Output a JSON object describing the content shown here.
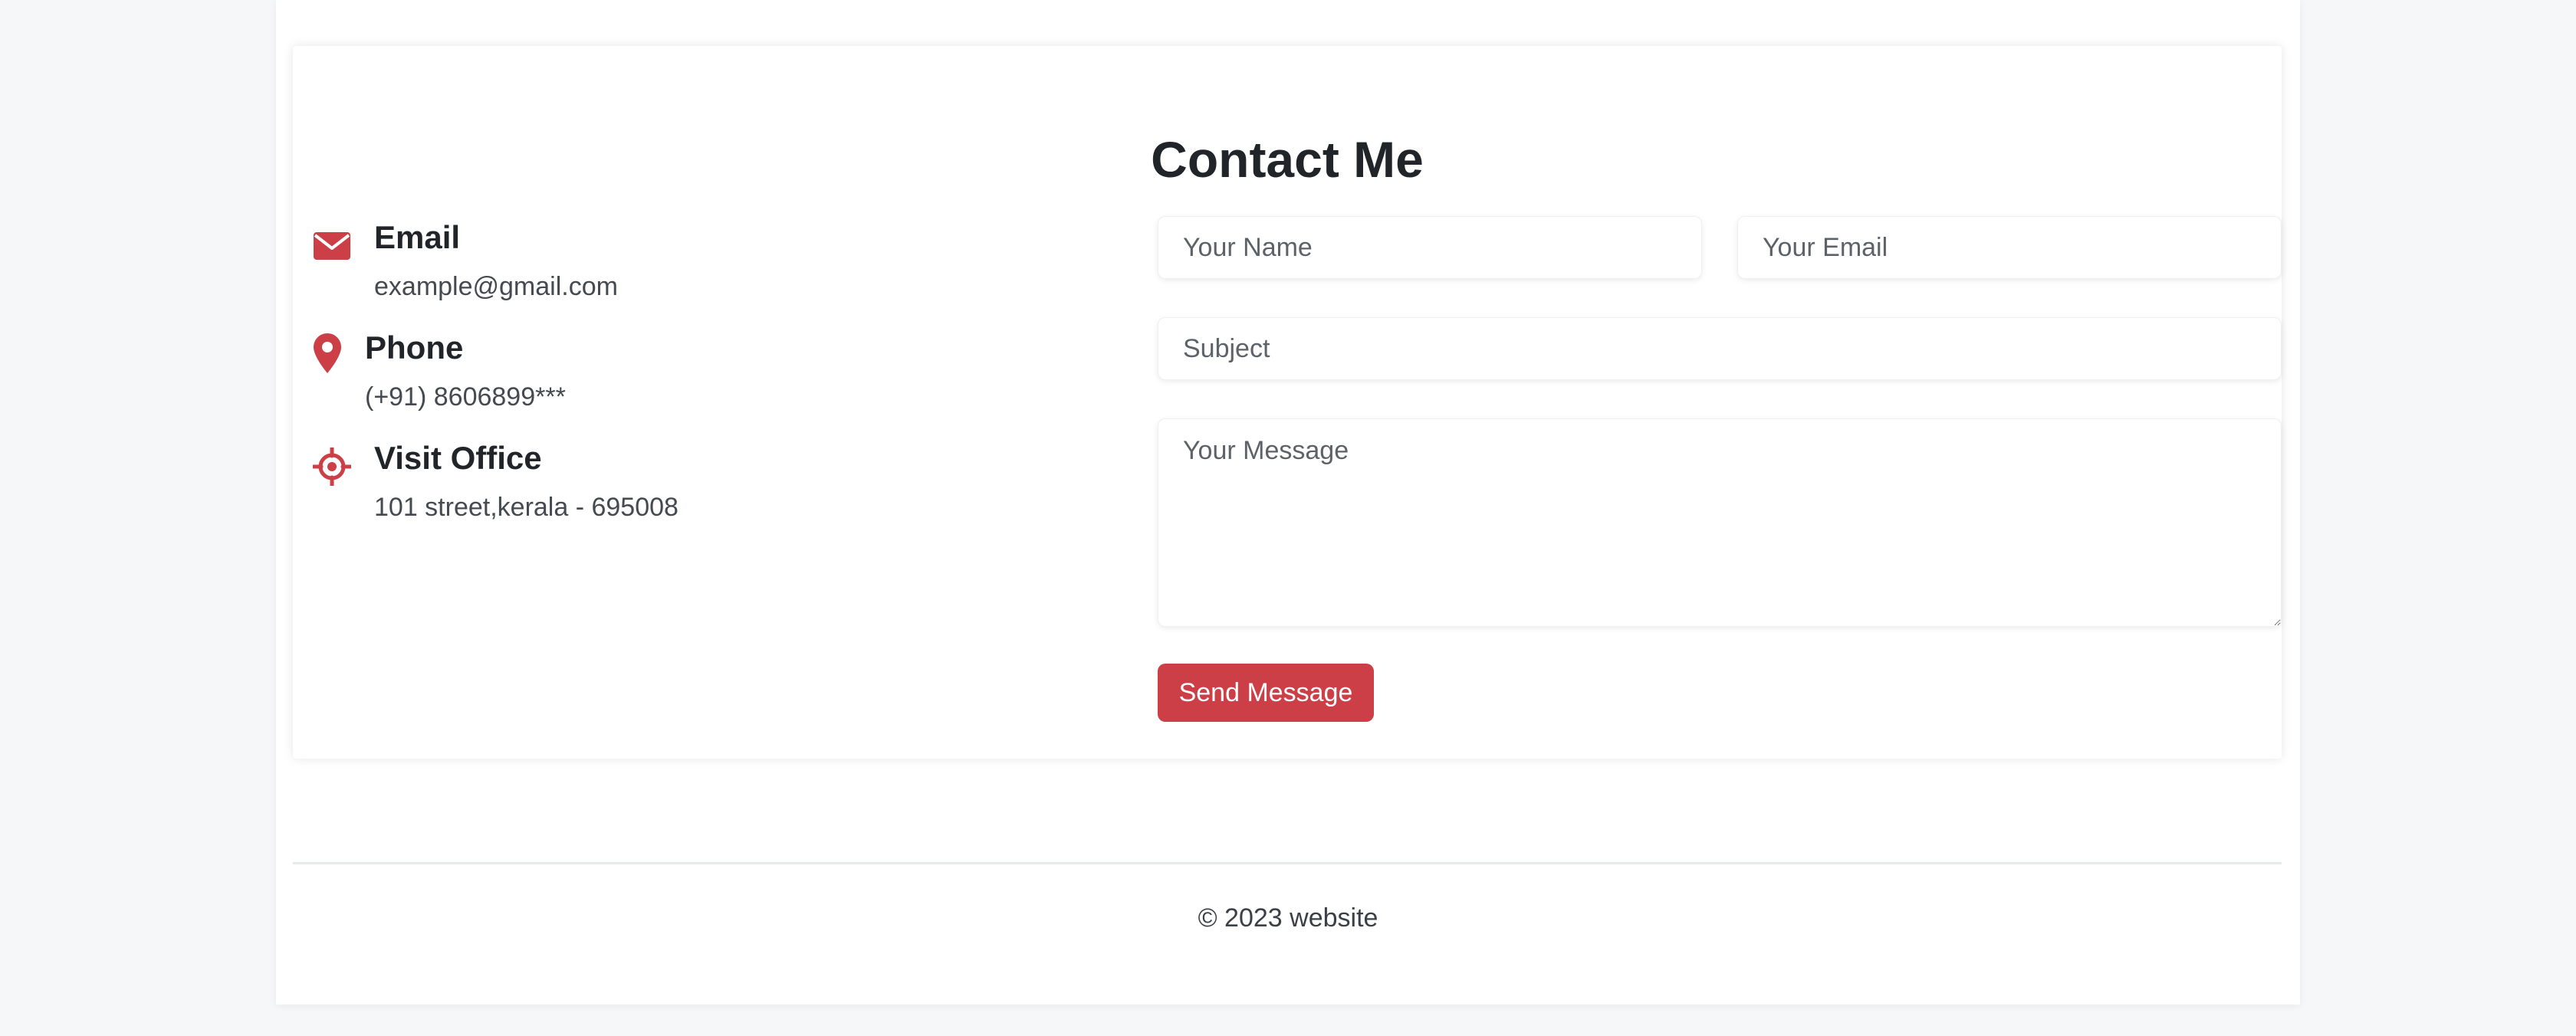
{
  "contact": {
    "title": "Contact Me",
    "accent_color": "#cc3f46",
    "info": [
      {
        "icon": "envelope-icon",
        "label": "Email",
        "value": "example@gmail.com"
      },
      {
        "icon": "map-pin-icon",
        "label": "Phone",
        "value": "(+91) 8606899***"
      },
      {
        "icon": "crosshair-icon",
        "label": "Visit Office",
        "value": "101 street,kerala - 695008"
      }
    ],
    "form": {
      "name_placeholder": "Your Name",
      "email_placeholder": "Your Email",
      "subject_placeholder": "Subject",
      "message_placeholder": "Your Message",
      "submit_label": "Send Message"
    }
  },
  "footer": {
    "copyright": "© 2023 website"
  }
}
